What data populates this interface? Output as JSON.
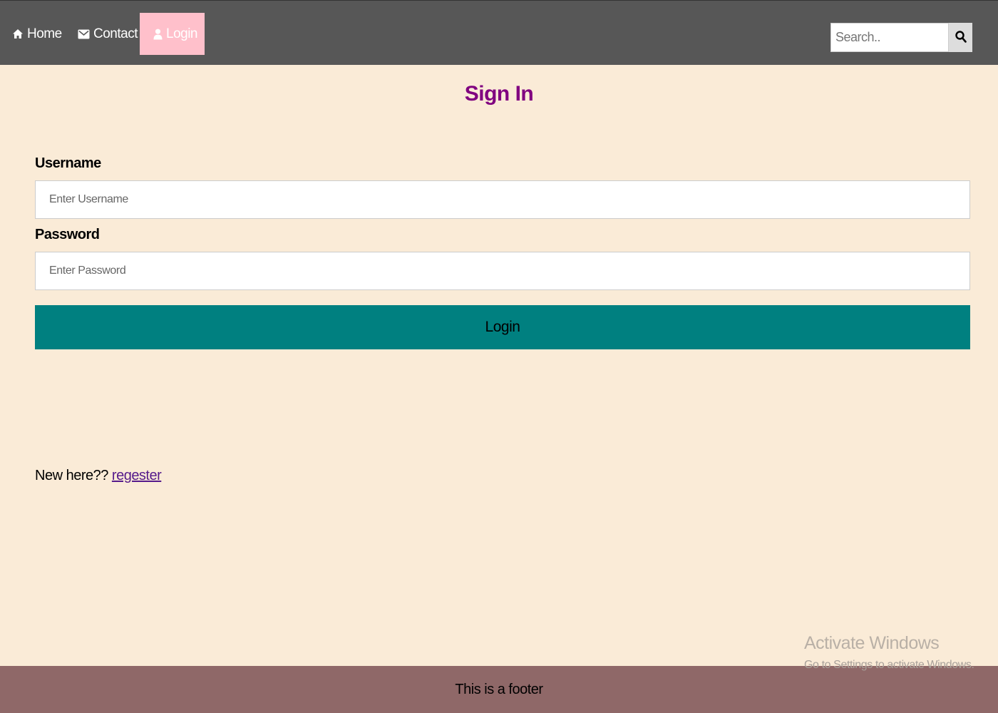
{
  "nav": {
    "items": [
      {
        "label": "Home",
        "icon": "home-icon"
      },
      {
        "label": "Contact",
        "icon": "envelope-icon"
      },
      {
        "label": "Login",
        "icon": "user-icon",
        "active": true
      }
    ],
    "search": {
      "placeholder": "Search..",
      "icon": "search-icon"
    }
  },
  "form": {
    "title": "Sign In",
    "username_label": "Username",
    "username_placeholder": "Enter Username",
    "password_label": "Password",
    "password_placeholder": "Enter Password",
    "submit_label": "Login"
  },
  "register": {
    "prompt": "New here??",
    "link_text": "regester"
  },
  "watermark": {
    "title": "Activate Windows",
    "subtitle": "Go to Settings to activate Windows."
  },
  "footer": {
    "text": "This is a footer"
  },
  "colors": {
    "nav_bg": "#575757",
    "active_nav_bg": "#ffc0cb",
    "page_bg": "#faebd7",
    "title": "#800080",
    "button_bg": "#008080",
    "footer_bg": "#8f6868",
    "link": "#551a8b"
  }
}
